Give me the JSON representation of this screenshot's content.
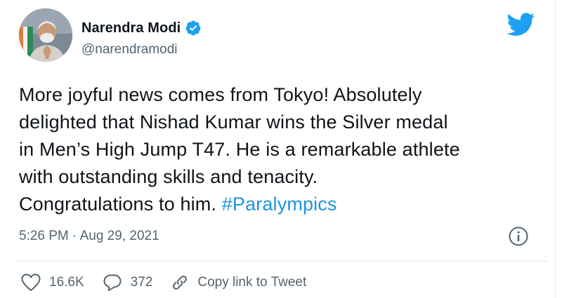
{
  "author": {
    "display_name": "Narendra Modi",
    "handle": "@narendramodi",
    "verified": true
  },
  "tweet": {
    "lines": [
      "More joyful news comes from Tokyo! Absolutely",
      "delighted that Nishad Kumar wins the Silver medal",
      "in Men’s High Jump T47. He is a remarkable athlete",
      "with outstanding skills and tenacity."
    ],
    "last_line_prefix": "Congratulations to him. ",
    "hashtag": "#Paralympics",
    "timestamp": "5:26 PM · Aug 29, 2021"
  },
  "actions": {
    "likes": "16.6K",
    "replies": "372",
    "copy_link": "Copy link to Tweet"
  },
  "colors": {
    "brand": "#1da1f2",
    "hashtag": "#1b95e0",
    "secondary_text": "#536471",
    "primary_text": "#0f1419"
  },
  "icons": {
    "logo": "twitter-bird-icon",
    "verified": "verified-badge-icon",
    "info": "info-icon",
    "like": "heart-icon",
    "reply": "reply-bubble-icon",
    "link": "link-icon"
  }
}
